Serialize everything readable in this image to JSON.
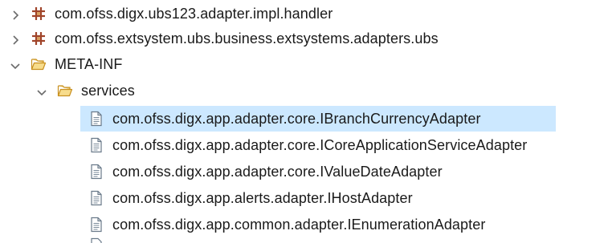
{
  "tree": {
    "items": [
      {
        "label": "com.ofss.digx.ubs123.adapter.impl.handler",
        "icon": "package-icon",
        "expander": "chevron-right-icon"
      },
      {
        "label": "com.ofss.extsystem.ubs.business.extsystems.adapters.ubs",
        "icon": "package-icon",
        "expander": "chevron-right-icon"
      },
      {
        "label": "META-INF",
        "icon": "folder-open-icon",
        "expander": "chevron-down-icon"
      },
      {
        "label": "services",
        "icon": "folder-open-icon",
        "expander": "chevron-down-icon"
      },
      {
        "label": "com.ofss.digx.app.adapter.core.IBranchCurrencyAdapter",
        "icon": "file-icon",
        "selected": true
      },
      {
        "label": "com.ofss.digx.app.adapter.core.ICoreApplicationServiceAdapter",
        "icon": "file-icon"
      },
      {
        "label": "com.ofss.digx.app.adapter.core.IValueDateAdapter",
        "icon": "file-icon"
      },
      {
        "label": "com.ofss.digx.app.alerts.adapter.IHostAdapter",
        "icon": "file-icon"
      },
      {
        "label": "com.ofss.digx.app.common.adapter.IEnumerationAdapter",
        "icon": "file-icon"
      }
    ]
  },
  "colors": {
    "selection": "#cce8ff",
    "package": "#a0442a",
    "folder": "#e8b84a",
    "chevron": "#6a6a6a"
  }
}
